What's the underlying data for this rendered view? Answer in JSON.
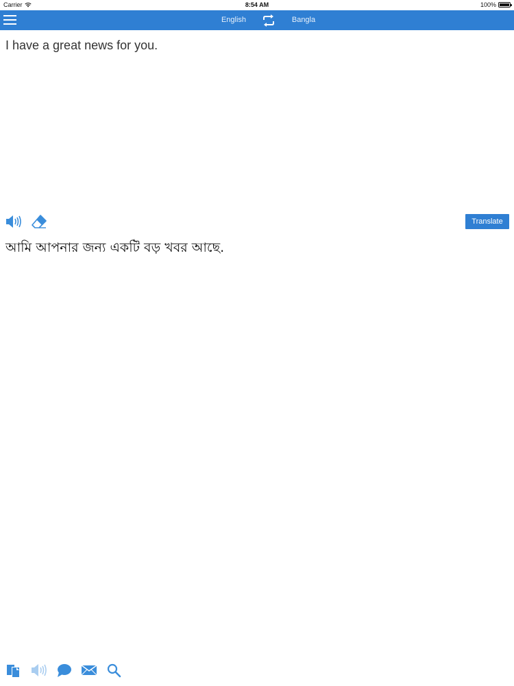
{
  "status_bar": {
    "carrier": "Carrier",
    "time": "8:54 AM",
    "battery": "100%",
    "battery_level": 1.0
  },
  "nav_bar": {
    "source_language": "English",
    "target_language": "Bangla",
    "icons": {
      "menu": "hamburger-menu-icon",
      "swap": "swap-languages-icon"
    }
  },
  "input": {
    "text": "I have a great news for you."
  },
  "toolbar": {
    "translate_label": "Translate",
    "icons": [
      "speaker-icon",
      "eraser-icon"
    ]
  },
  "output": {
    "text": "আমি আপনার জন্য একটি বড় খবর আছে."
  },
  "bottom_toolbar": {
    "icons": [
      "copy-icon",
      "speaker-icon",
      "chat-bubble-icon",
      "envelope-icon",
      "search-icon"
    ]
  },
  "colors": {
    "accent": "#2f7fd3",
    "icon": "#3a8ddb",
    "nav_text": "#e8f1fb"
  }
}
